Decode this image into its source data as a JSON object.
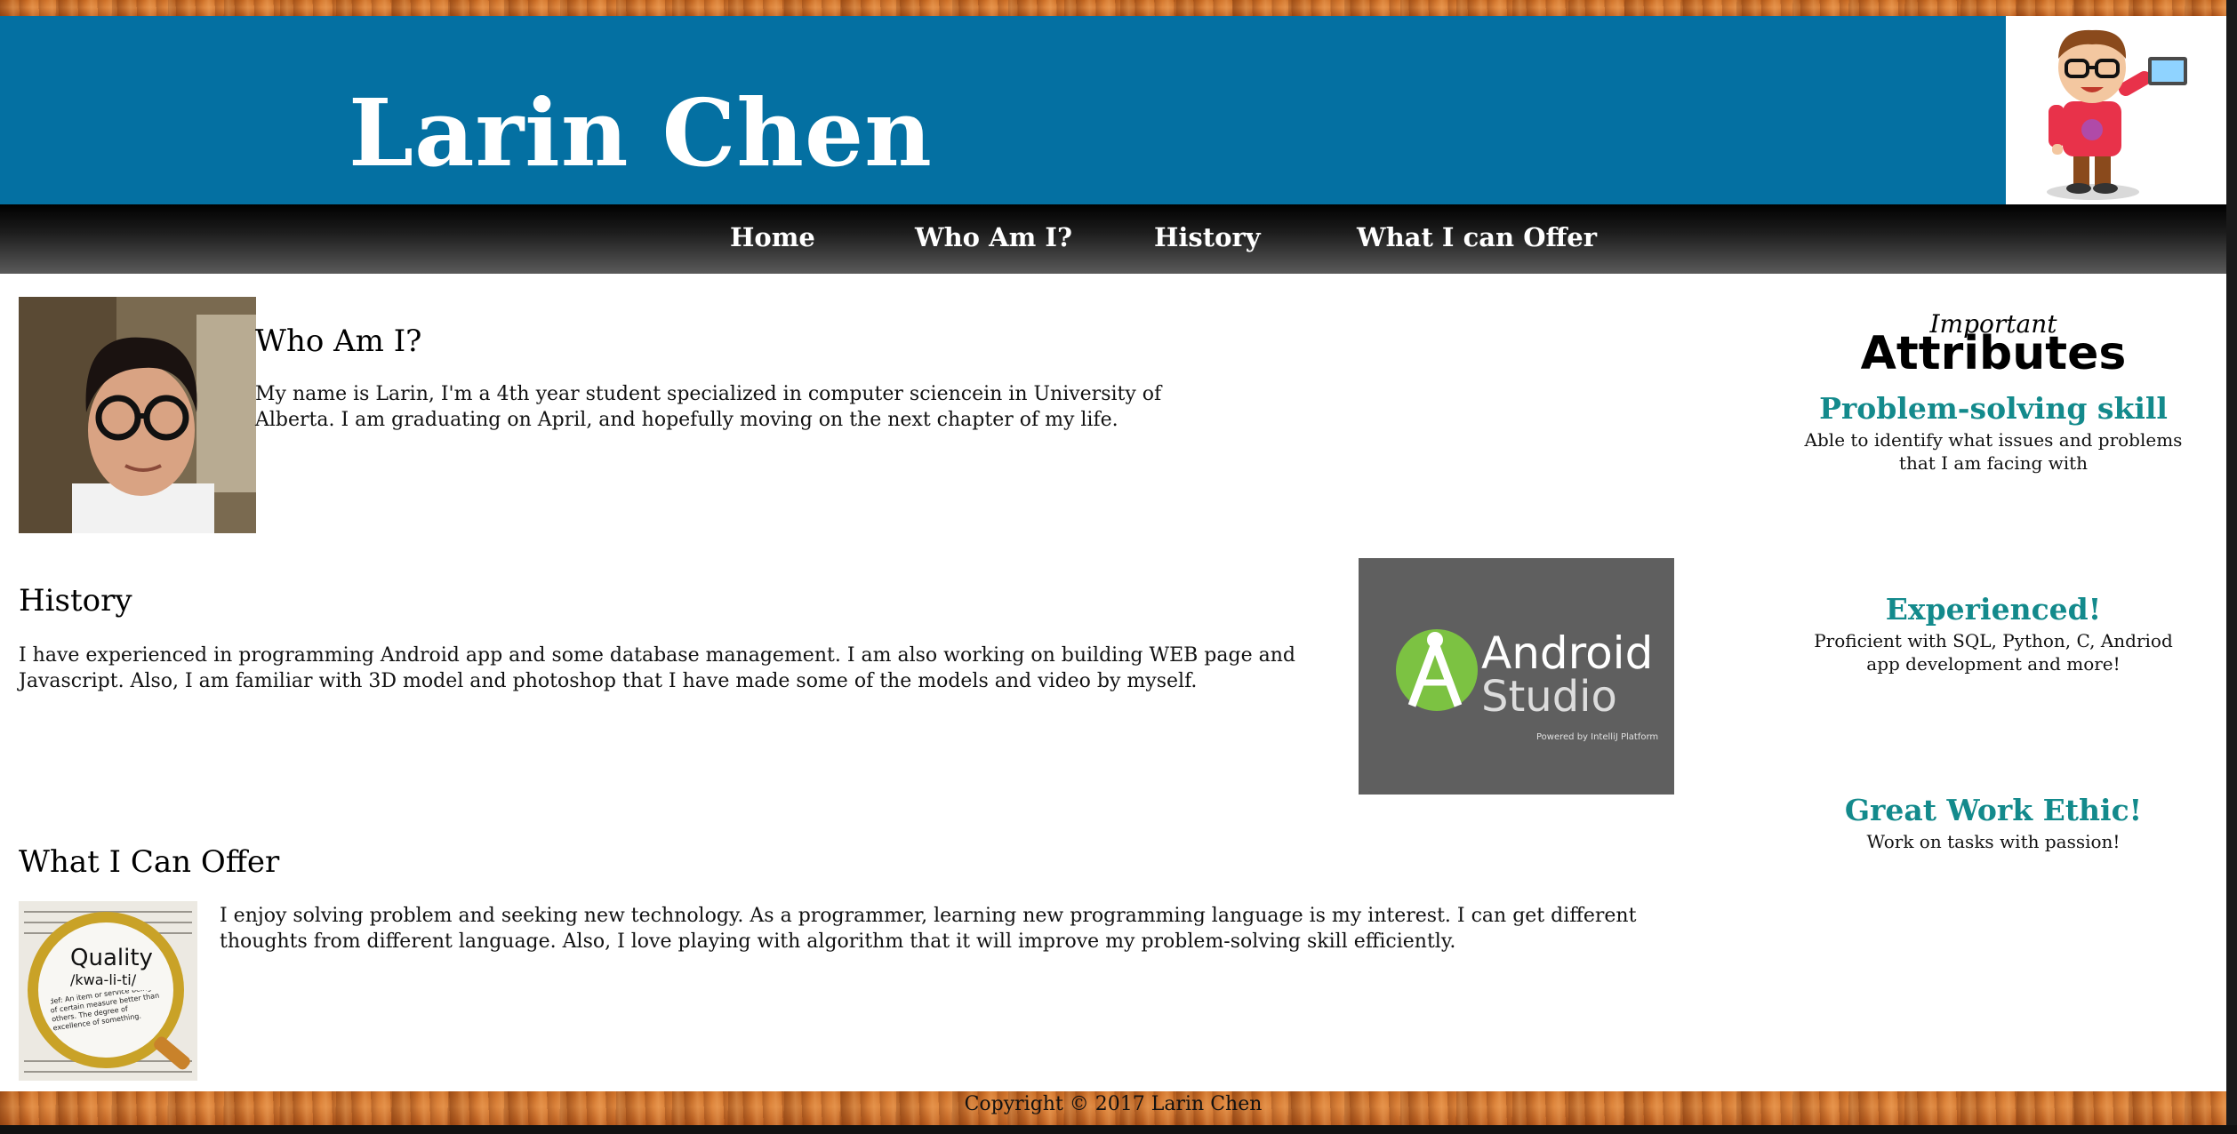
{
  "header": {
    "site_title": "Larin Chen",
    "bg_color": "#0470a2"
  },
  "nav": {
    "items": [
      {
        "label": "Home"
      },
      {
        "label": "Who Am I?"
      },
      {
        "label": "History"
      },
      {
        "label": "What I can Offer"
      }
    ]
  },
  "sections": {
    "who": {
      "title": "Who Am I?",
      "body": "My name is Larin, I'm a 4th year student specialized in computer sciencein in University of Alberta. I am graduating on April, and hopefully moving on the next chapter of my life."
    },
    "history": {
      "title": "History",
      "body": "I have experienced in programming Android app and some database management. I am also working on building WEB page and Javascript. Also, I am familiar with 3D model and photoshop that I have made some of the models and video by myself.",
      "image": {
        "line1": "Android",
        "line2": "Studio",
        "caption": "Powered by IntelliJ Platform"
      }
    },
    "offer": {
      "title": "What I Can Offer",
      "body": "I enjoy solving problem and seeking new technology. As a programmer, learning new programming language is my interest. I can get different thoughts from different language. Also, I love playing with algorithm that it will improve my problem-solving skill efficiently.",
      "image": {
        "word": "Quality",
        "phonetic": "/kwa-li-ti/",
        "definition": "def: An item or service being of certain measure better than others. The degree of excellence of something."
      }
    }
  },
  "sidebar": {
    "kicker": "Important",
    "heading": "Attributes",
    "accent_color": "#138a8c",
    "attributes": [
      {
        "title": "Problem-solving skill",
        "desc": "Able to identify what issues and problems that I am facing with"
      },
      {
        "title": "Experienced!",
        "desc": "Proficient with SQL, Python, C, Andriod app development and more!"
      },
      {
        "title": "Great Work Ethic!",
        "desc": "Work on tasks with passion!"
      }
    ]
  },
  "footer": {
    "copyright": "Copyright © 2017 Larin Chen"
  }
}
